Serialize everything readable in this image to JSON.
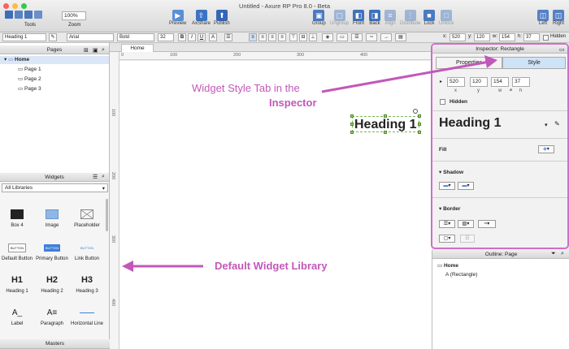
{
  "window": {
    "title": "Untitled - Axure RP Pro 8.0 - Beta",
    "traffic_colors": [
      "#fc605c",
      "#fdbc40",
      "#34c84a"
    ]
  },
  "toolbar": {
    "tools_label": "Tools",
    "zoom_value": "100%",
    "zoom_label": "Zoom",
    "buttons": [
      {
        "label": "Preview",
        "icon": "preview-icon"
      },
      {
        "label": "AxShare",
        "icon": "axshare-icon"
      },
      {
        "label": "Publish",
        "icon": "publish-icon"
      },
      {
        "label": "Group",
        "icon": "group-icon"
      },
      {
        "label": "Ungroup",
        "icon": "ungroup-icon"
      },
      {
        "label": "Front",
        "icon": "bring-front-icon"
      },
      {
        "label": "Back",
        "icon": "send-back-icon"
      },
      {
        "label": "Align",
        "icon": "align-icon"
      },
      {
        "label": "Distribute",
        "icon": "distribute-icon"
      },
      {
        "label": "Lock",
        "icon": "lock-icon"
      },
      {
        "label": "Unlock",
        "icon": "unlock-icon"
      },
      {
        "label": "Left",
        "icon": "left-panel-icon"
      },
      {
        "label": "Right",
        "icon": "right-panel-icon"
      }
    ]
  },
  "formatbar": {
    "style": "Heading 1",
    "font": "Arial",
    "weight": "Bold",
    "size": "32",
    "bold": "B",
    "italic": "I",
    "underline": "U",
    "x_label": "x:",
    "x": "520",
    "y_label": "y:",
    "y": "120",
    "w_label": "w:",
    "w": "154",
    "h_label": "h:",
    "h": "37",
    "hidden_label": "Hidden"
  },
  "pages": {
    "title": "Pages",
    "items": [
      "Home",
      "Page 1",
      "Page 2",
      "Page 3"
    ]
  },
  "widgets": {
    "title": "Widgets",
    "library": "All Libraries",
    "items": [
      {
        "label": "Box 4",
        "icon": "box-icon"
      },
      {
        "label": "Image",
        "icon": "image-icon"
      },
      {
        "label": "Placeholder",
        "icon": "placeholder-icon"
      },
      {
        "label": "Default Button",
        "icon": "button-icon",
        "icon_text": "BUTTON"
      },
      {
        "label": "Primary Button",
        "icon": "primary-button-icon",
        "icon_text": "BUTTON"
      },
      {
        "label": "Link Button",
        "icon": "link-button-icon",
        "icon_text": "BUTTON"
      },
      {
        "label": "Heading 1",
        "icon": "h1-icon",
        "icon_text": "H1"
      },
      {
        "label": "Heading 2",
        "icon": "h2-icon",
        "icon_text": "H2"
      },
      {
        "label": "Heading 3",
        "icon": "h3-icon",
        "icon_text": "H3"
      },
      {
        "label": "Label",
        "icon": "label-icon",
        "icon_text": "A_"
      },
      {
        "label": "Paragraph",
        "icon": "paragraph-icon",
        "icon_text": "A≡"
      },
      {
        "label": "Horizontal Line",
        "icon": "hline-icon"
      }
    ]
  },
  "masters": {
    "title": "Masters"
  },
  "canvas": {
    "tab": "Home",
    "ruler_top": [
      "0",
      "100",
      "200",
      "300",
      "400"
    ],
    "ruler_left": [
      "100",
      "200",
      "300",
      "400"
    ],
    "element_text": "Heading 1"
  },
  "inspector": {
    "title": "Inspector: Rectangle",
    "tab_properties": "Properties",
    "tab_style": "Style",
    "x": "520",
    "y": "120",
    "w": "154",
    "h": "37",
    "x_label": "x",
    "y_label": "y",
    "w_label": "w",
    "h_label": "h",
    "hidden_label": "Hidden",
    "style_name": "Heading 1",
    "fill_label": "Fill",
    "shadow_label": "Shadow",
    "border_label": "Border"
  },
  "outline": {
    "title": "Outline: Page",
    "root": "Home",
    "child": "(Rectangle)"
  },
  "annotations": {
    "style_tab_line1": "Widget Style Tab in the",
    "style_tab_line2": "Inspector",
    "library": "Default Widget Library",
    "color": "#c258b9"
  }
}
